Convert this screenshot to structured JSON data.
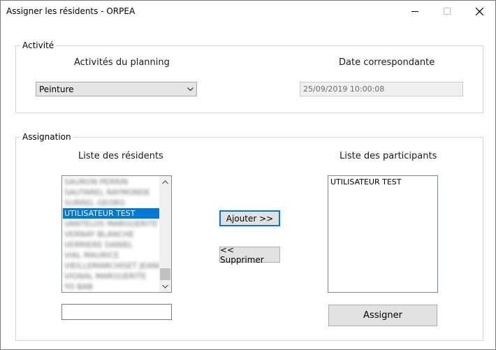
{
  "window": {
    "title": "Assigner les résidents - ORPEA"
  },
  "activite": {
    "legend": "Activité",
    "planning_label": "Activités du planning",
    "planning_selected": "Peinture",
    "date_label": "Date correspondante",
    "date_value": "25/09/2019 10:00:08"
  },
  "assignation": {
    "legend": "Assignation",
    "residents_label": "Liste des résidents",
    "participants_label": "Liste des participants",
    "residents": [
      {
        "text": "SAURON PERRIN",
        "state": "blurred"
      },
      {
        "text": "SAUTAREL RAYMONDE",
        "state": "blurred"
      },
      {
        "text": "SURREL GEORG",
        "state": "blurred"
      },
      {
        "text": "UTILISATEUR TEST",
        "state": "selected"
      },
      {
        "text": "VANTELOS MARGUERITE",
        "state": "blurred"
      },
      {
        "text": "VERNAY BLANCHE",
        "state": "blurred"
      },
      {
        "text": "VERRIERE DANIEL",
        "state": "blurred"
      },
      {
        "text": "VIAL MAURICE",
        "state": "blurred"
      },
      {
        "text": "VIEILLEMARCHISET JEANI",
        "state": "blurred"
      },
      {
        "text": "VIGNAL MARGUERITE",
        "state": "blurred"
      },
      {
        "text": "YO BAB",
        "state": "blurred"
      }
    ],
    "participants": [
      "UTILISATEUR TEST"
    ],
    "search_value": "",
    "ajouter_label": "Ajouter >>",
    "supprimer_label": "<< Supprimer",
    "assigner_label": "Assigner"
  }
}
